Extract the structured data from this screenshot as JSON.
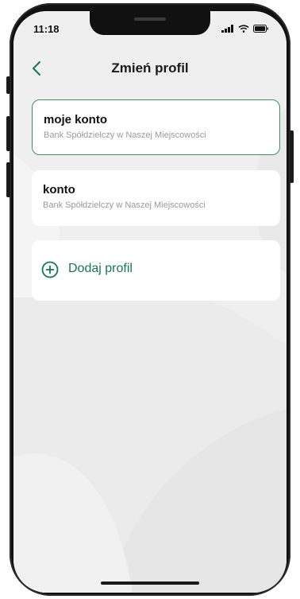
{
  "status_bar": {
    "time": "11:18",
    "icons": [
      "signal-icon",
      "wifi-icon",
      "battery-icon"
    ]
  },
  "header": {
    "back_icon": "chevron-left-icon",
    "title": "Zmień profil"
  },
  "profiles": [
    {
      "name": "moje konto",
      "bank": "Bank Spółdzielczy w Naszej Miejscowości",
      "selected": true
    },
    {
      "name": "konto",
      "bank": "Bank Spółdzielczy w Naszej Miejscowości",
      "selected": false
    }
  ],
  "add_profile": {
    "icon": "plus-circle-icon",
    "label": "Dodaj profil"
  },
  "colors": {
    "accent": "#16794b",
    "selected_border": "#3f8f63",
    "background": "#eeeeee",
    "card": "#ffffff"
  }
}
